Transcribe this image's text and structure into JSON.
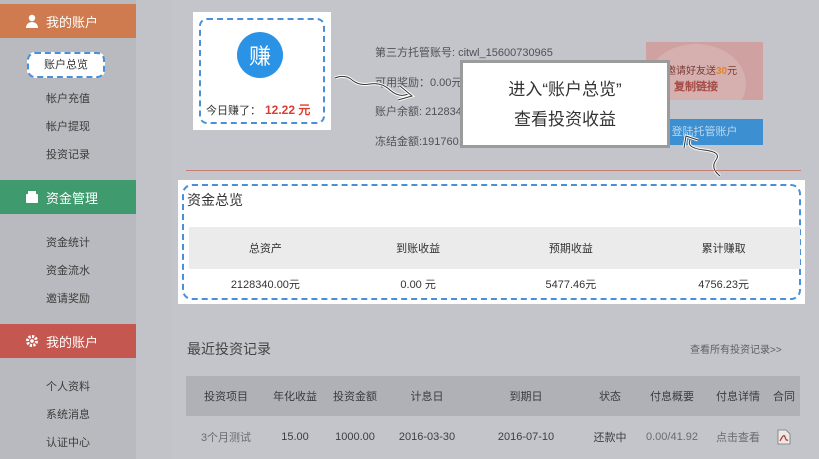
{
  "sidebar": {
    "sections": [
      {
        "title": "我的账户",
        "icon": "user-icon"
      },
      {
        "title": "资金管理",
        "icon": "money-icon"
      },
      {
        "title": "我的账户",
        "icon": "gear-icon"
      }
    ],
    "account_items": [
      "账户总览",
      "帐户充值",
      "帐户提现",
      "投资记录"
    ],
    "fund_items": [
      "资金统计",
      "资金流水",
      "邀请奖励"
    ],
    "profile_items": [
      "个人资料",
      "系统消息",
      "认证中心"
    ]
  },
  "earnings": {
    "badge": "赚",
    "label": "今日赚了：",
    "amount": "12.22 元"
  },
  "account_info": {
    "custody_account": "第三方托管账号: citwl_15600730965",
    "available_reward": "可用奖励：0.00元",
    "balance": "账户余额: 2128340.00元",
    "frozen": "冻结金额:191760.00"
  },
  "promo": {
    "line1_prefix": "邀请好友送",
    "line1_amount": "30",
    "line1_suffix": "元",
    "line2": "复制链接",
    "trust_button": "登陆托管账户"
  },
  "callout": {
    "line1": "进入“账户总览”",
    "line2": "查看投资收益"
  },
  "overview": {
    "title": "资金总览",
    "headers": [
      "总资产",
      "到账收益",
      "预期收益",
      "累计赚取"
    ],
    "values": [
      "2128340.00元",
      "0.00 元",
      "5477.46元",
      "4756.23元"
    ]
  },
  "recent": {
    "title": "最近投资记录",
    "view_all": "查看所有投资记录>>",
    "headers": [
      "投资项目",
      "年化收益",
      "投资金额",
      "计息日",
      "到期日",
      "状态",
      "付息概要",
      "付息详情",
      "合同"
    ],
    "rows": [
      [
        "3个月测试",
        "15.00",
        "1000.00",
        "2016-03-30",
        "2016-07-10",
        "还款中",
        "0.00/41.92",
        "点击查看",
        ""
      ]
    ]
  },
  "colors": {
    "accent_blue": "#4a90d9",
    "earn_red": "#e03b2f",
    "sidebar_orange": "#cf7a4f",
    "sidebar_green": "#3f9a6e",
    "sidebar_red": "#c4574f"
  }
}
